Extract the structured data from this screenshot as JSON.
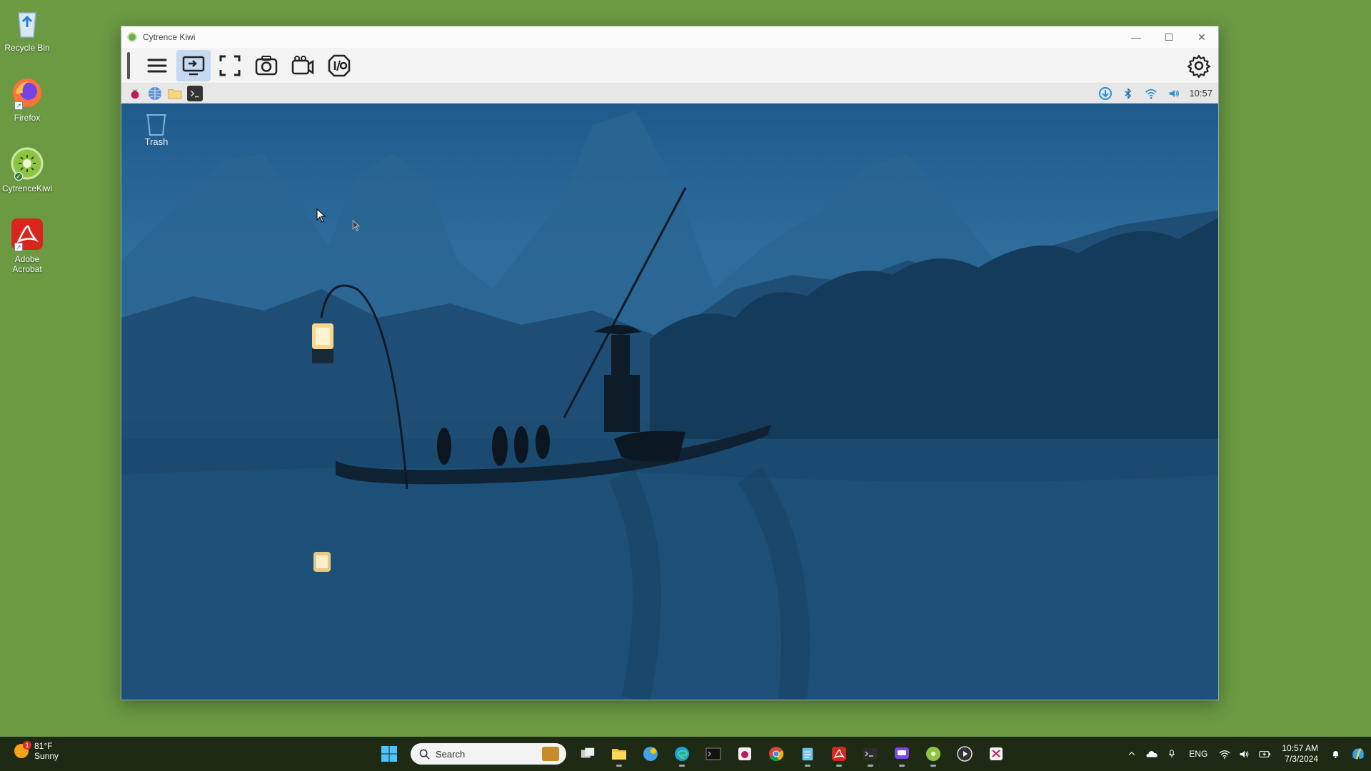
{
  "desktop": {
    "icons": [
      {
        "label": "Recycle Bin",
        "icon": "recycle-bin-icon"
      },
      {
        "label": "Firefox",
        "icon": "firefox-icon"
      },
      {
        "label": "CytrenceKiwi",
        "icon": "kiwi-icon"
      },
      {
        "label": "Adobe Acrobat",
        "icon": "acrobat-icon"
      }
    ]
  },
  "window": {
    "title": "Cytrence Kiwi",
    "toolbar": [
      "menu-icon",
      "remote-desktop-icon",
      "fullscreen-icon",
      "screenshot-icon",
      "record-video-icon",
      "io-icon",
      "settings-icon"
    ],
    "remote": {
      "taskbar_icons": [
        "raspberry-pi-menu-icon",
        "browser-icon",
        "file-manager-icon",
        "terminal-icon"
      ],
      "tray": [
        "update-icon",
        "bluetooth-icon",
        "wifi-icon",
        "volume-icon"
      ],
      "clock": "10:57",
      "trash_label": "Trash"
    }
  },
  "taskbar": {
    "weather": {
      "temp": "81°F",
      "condition": "Sunny",
      "badge": "1"
    },
    "search_placeholder": "Search",
    "language": "ENG",
    "time": "10:57 AM",
    "date": "7/3/2024"
  },
  "colors": {
    "desktop_bg": "#6b9a43",
    "taskbar_bg": "#1f2a14",
    "active_toolbar": "#c5d9f1"
  }
}
